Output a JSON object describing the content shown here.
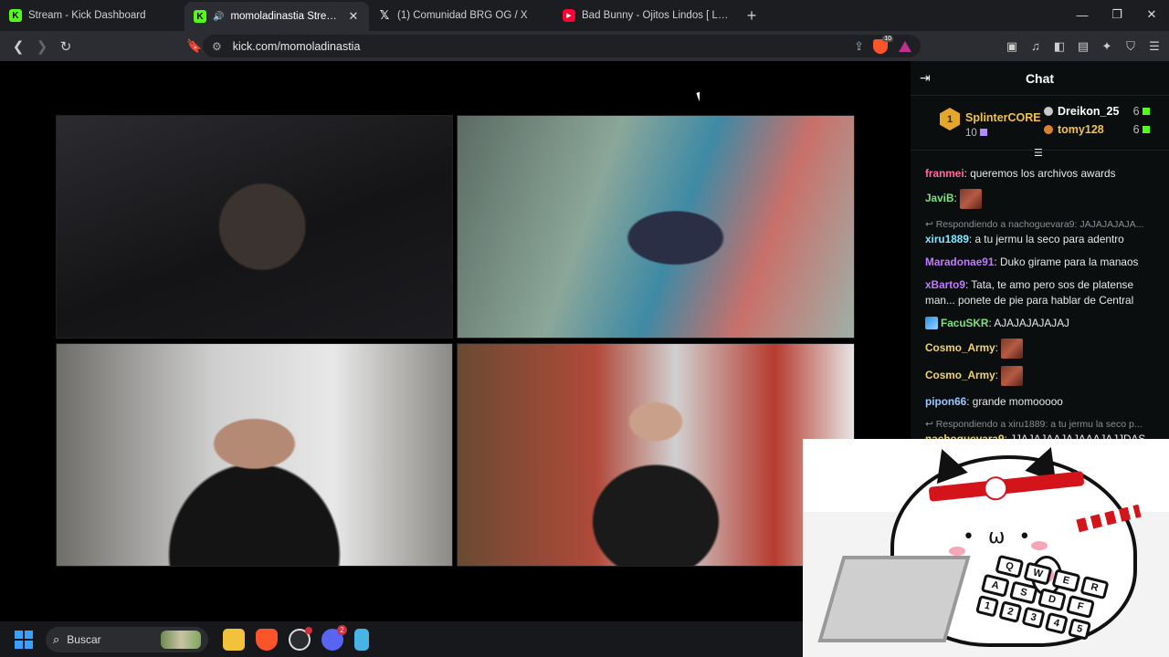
{
  "browser": {
    "tabs": [
      {
        "title": "Stream - Kick Dashboard",
        "favicon": "kick"
      },
      {
        "title": "momoladinastia Stream - Wat",
        "favicon": "kick",
        "active": true
      },
      {
        "title": "(1) Comunidad BRG OG / X",
        "favicon": "x"
      },
      {
        "title": "Bad Bunny - Ojitos Lindos [ Letra/Lyr",
        "favicon": "youtube"
      }
    ],
    "url": "kick.com/momoladinastia",
    "brave_shield_count": "10"
  },
  "chat": {
    "title": "Chat",
    "leaderboard": {
      "first": {
        "rank": "1",
        "name": "SplinterCORE",
        "count": "10"
      },
      "second": {
        "name": "Dreikon_25",
        "count": "6"
      },
      "third": {
        "name": "tomy128",
        "count": "6"
      }
    },
    "messages": [
      {
        "user": "franmei",
        "text": "queremos los archivos awards",
        "color": "#ff6b9a"
      },
      {
        "user": "JaviB",
        "text": "",
        "color": "#7ee07e",
        "emote": true
      },
      {
        "reply": "Respondiendo a nachoguevara9: JAJAJAJAJA...",
        "user": "xiru1889",
        "text": "a tu jermu la seco para adentro",
        "color": "#7fe8ff"
      },
      {
        "user": "Maradonae91",
        "text": "Duko girame para la manaos",
        "color": "#c07bff"
      },
      {
        "user": "xBarto9",
        "text": "Tata, te amo pero sos de platense man... ponete de pie para hablar de Central",
        "color": "#c07bff"
      },
      {
        "user": "FacuSKR",
        "text": "AJAJAJAJAJAJ",
        "color": "#7ee07e",
        "badge": true
      },
      {
        "user": "Cosmo_Army",
        "text": "",
        "color": "#f0d36c",
        "emote": true
      },
      {
        "user": "Cosmo_Army",
        "text": "",
        "color": "#f0d36c",
        "emote": true
      },
      {
        "user": "pipon66",
        "text": "grande momooooo",
        "color": "#9cc7ff"
      },
      {
        "reply": "Respondiendo a xiru1889: a tu jermu la seco p...",
        "user": "nachoguevara9",
        "text": "JJAJAJAAJAJAAAJAJJDAS",
        "color": "#f0d36c"
      }
    ]
  },
  "overlay": {
    "keys": [
      "Q",
      "W",
      "E",
      "R",
      "A",
      "S",
      "D",
      "F",
      "1",
      "2",
      "3",
      "4",
      "5"
    ]
  },
  "taskbar": {
    "search_placeholder": "Buscar",
    "discord_badge": "2"
  },
  "colors": {
    "kick_green": "#53fc18",
    "chat_bg": "#0b0e0f",
    "gold": "#f2c14e"
  }
}
